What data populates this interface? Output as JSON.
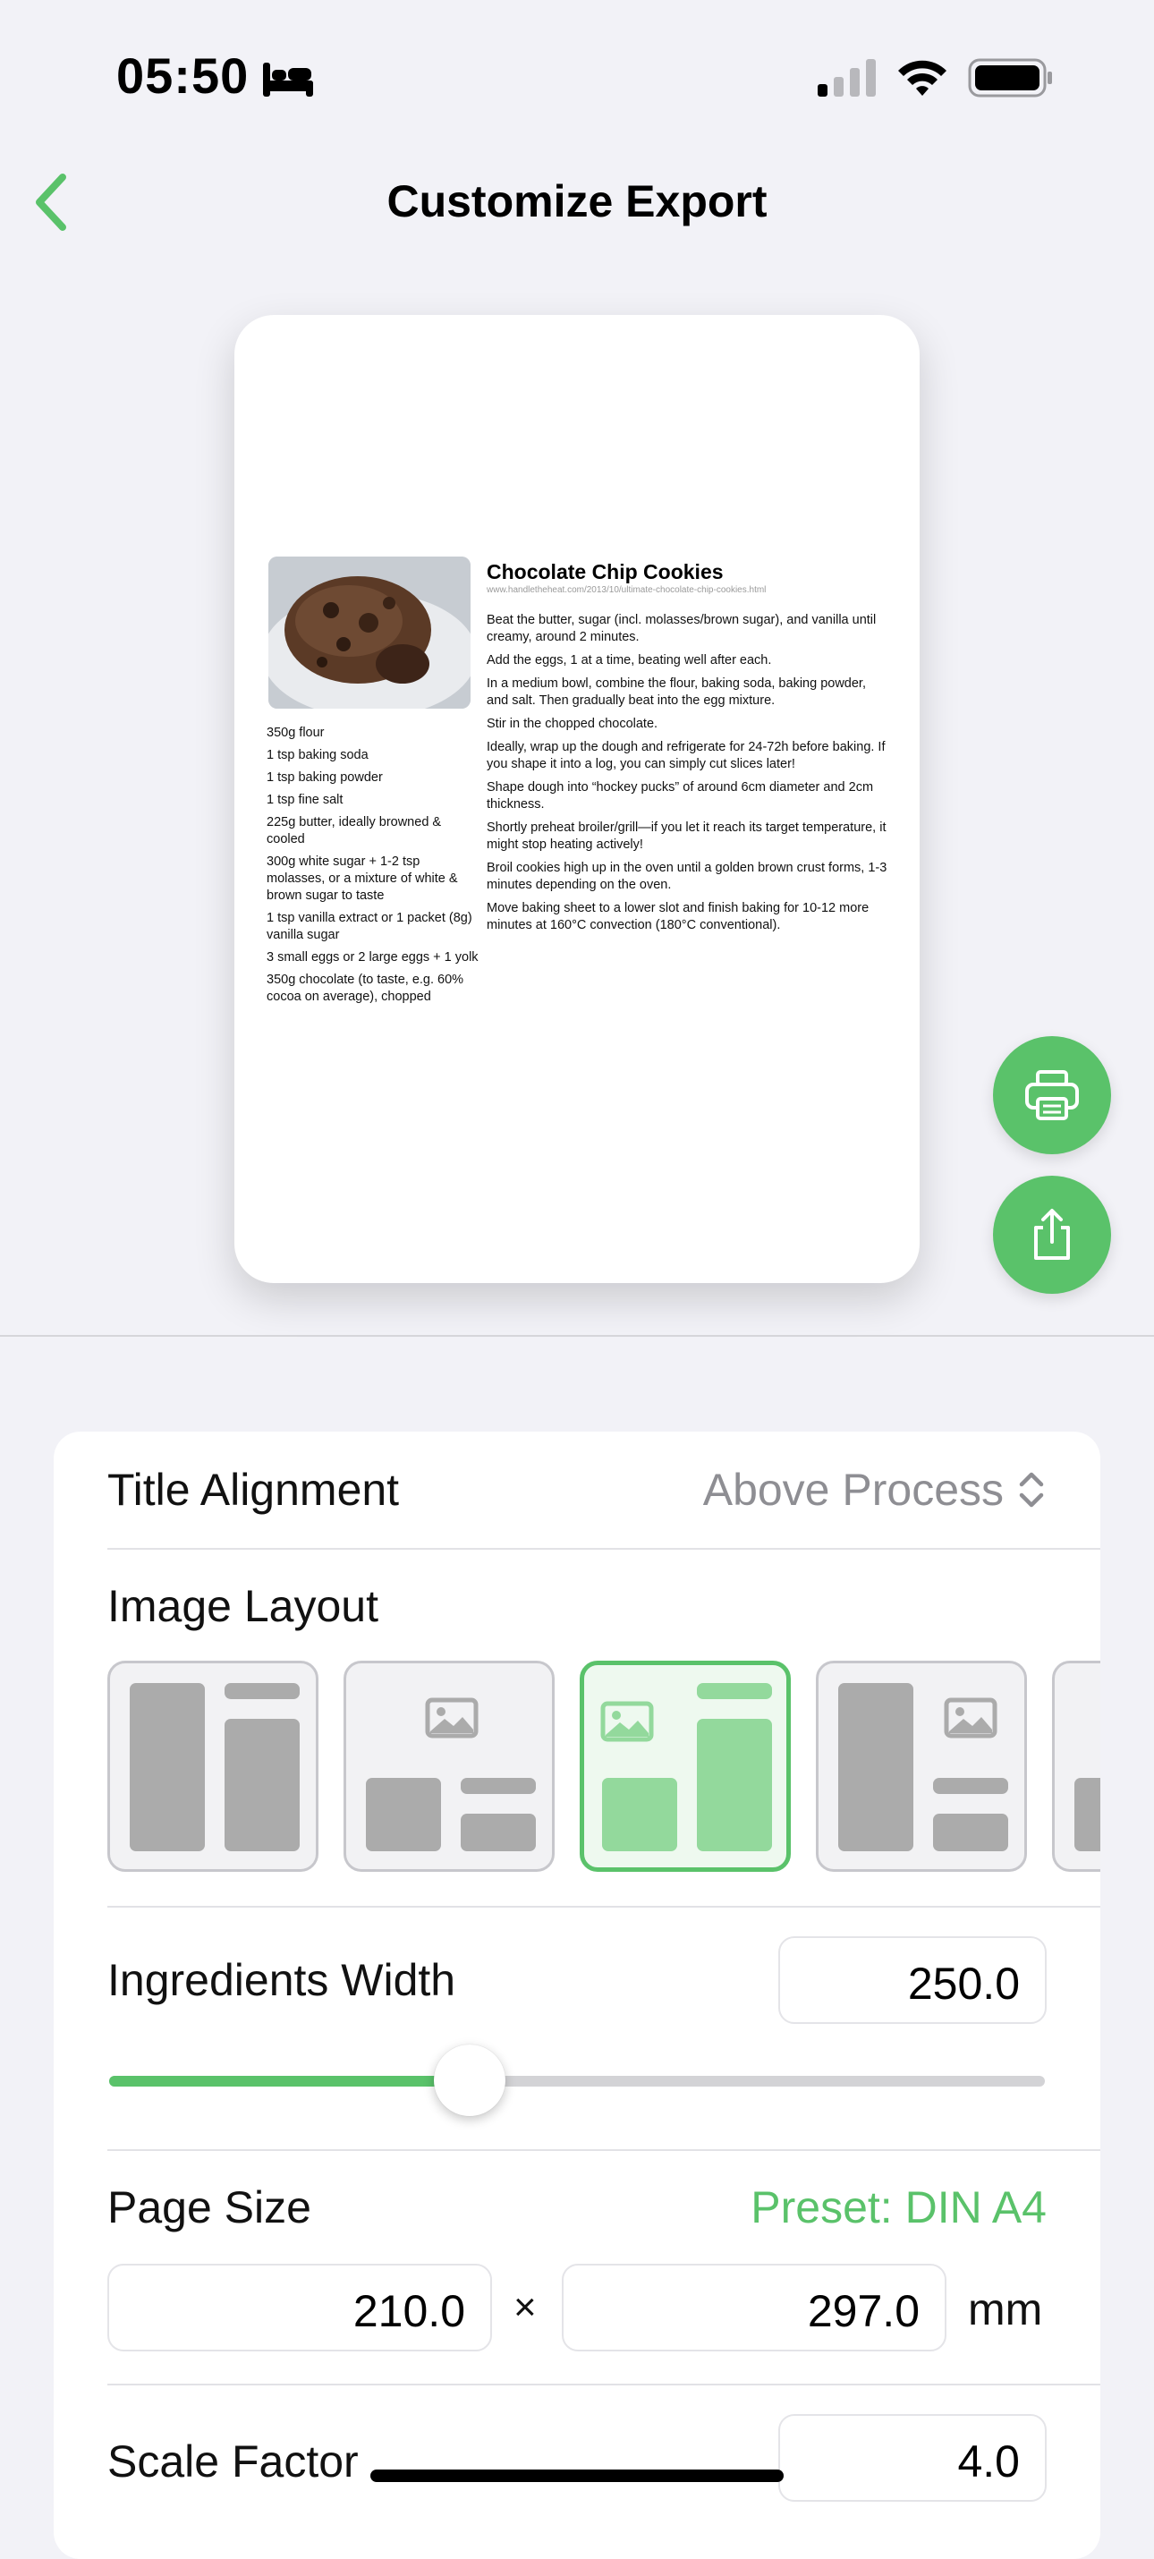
{
  "status_bar": {
    "time": "05:50"
  },
  "nav": {
    "title": "Customize Export"
  },
  "preview": {
    "recipe_title": "Chocolate Chip Cookies",
    "source_url": "www.handletheheat.com/2013/10/ultimate-chocolate-chip-cookies.html",
    "ingredients": [
      "350g flour",
      "1 tsp baking soda",
      "1 tsp baking powder",
      "1 tsp fine salt",
      "225g butter, ideally browned & cooled",
      "300g white sugar + 1-2 tsp molasses, or a mixture of white & brown sugar to taste",
      "1 tsp vanilla extract or 1 packet (8g) vanilla sugar",
      "3 small eggs or 2 large eggs + 1 yolk",
      "350g chocolate (to taste, e.g. 60% cocoa on average), chopped"
    ],
    "steps": [
      "Beat the butter, sugar (incl. molasses/brown sugar), and vanilla until creamy, around 2 minutes.",
      "Add the eggs, 1 at a time, beating well after each.",
      "In a medium bowl, combine the flour, baking soda, baking powder, and salt. Then gradually beat into the egg mixture.",
      "Stir in the chopped chocolate.",
      "Ideally, wrap up the dough and refrigerate for 24-72h before baking. If you shape it into a log, you can simply cut slices later!",
      "Shape dough into “hockey pucks” of around 6cm diameter and 2cm thickness.",
      "Shortly preheat broiler/grill—if you let it reach its target temperature, it might stop heating actively!",
      "Broil cookies high up in the oven until a golden brown crust forms, 1-3 minutes depending on the oven.",
      "Move baking sheet to a lower slot and finish baking for 10-12 more minutes at 160°C convection (180°C conventional)."
    ]
  },
  "actions": {
    "print_icon": "printer-icon",
    "share_icon": "share-icon"
  },
  "settings": {
    "title_alignment": {
      "label": "Title Alignment",
      "value": "Above Process"
    },
    "image_layout": {
      "label": "Image Layout",
      "selected_index": 2,
      "option_count": 5
    },
    "ingredients_width": {
      "label": "Ingredients Width",
      "value": "250.0",
      "slider_fraction": 0.385
    },
    "page_size": {
      "label": "Page Size",
      "preset": "Preset: DIN A4",
      "width": "210.0",
      "times": "×",
      "height": "297.0",
      "unit": "mm"
    },
    "scale_factor": {
      "label": "Scale Factor",
      "value": "4.0"
    }
  },
  "colors": {
    "accent": "#5ac26a",
    "background": "#f2f2f7",
    "secondary_text": "#8e8e93"
  }
}
